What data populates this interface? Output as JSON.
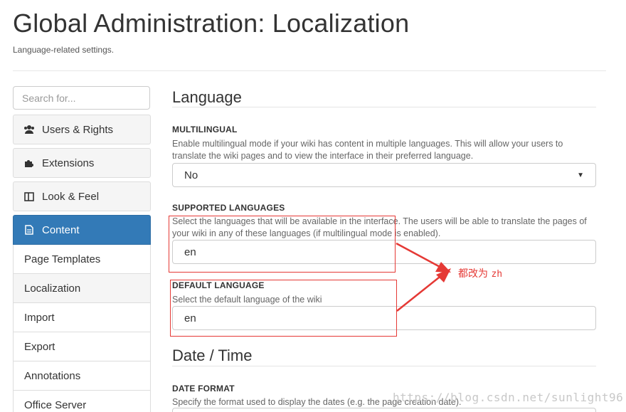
{
  "header": {
    "title": "Global Administration: Localization",
    "subtitle": "Language-related settings."
  },
  "sidebar": {
    "search_placeholder": "Search for...",
    "categories": [
      {
        "label": "Users & Rights",
        "icon": "users-icon"
      },
      {
        "label": "Extensions",
        "icon": "puzzle-icon"
      },
      {
        "label": "Look & Feel",
        "icon": "columns-icon"
      },
      {
        "label": "Content",
        "icon": "document-icon",
        "active": true
      }
    ],
    "sub_items": [
      {
        "label": "Page Templates"
      },
      {
        "label": "Localization",
        "selected": true
      },
      {
        "label": "Import"
      },
      {
        "label": "Export"
      },
      {
        "label": "Annotations"
      },
      {
        "label": "Office Server"
      }
    ]
  },
  "main": {
    "language_section": {
      "title": "Language",
      "multilingual": {
        "label": "MULTILINGUAL",
        "help": "Enable multilingual mode if your wiki has content in multiple languages. This will allow your users to translate the wiki pages and to view the interface in their preferred language.",
        "value": "No"
      },
      "supported_languages": {
        "label": "SUPPORTED LANGUAGES",
        "help": "Select the languages that will be available in the interface. The users will be able to translate the pages of your wiki in any of these languages (if multilingual mode is enabled).",
        "value": "en"
      },
      "default_language": {
        "label": "DEFAULT LANGUAGE",
        "help": "Select the default language of the wiki",
        "value": "en"
      }
    },
    "datetime_section": {
      "title": "Date / Time",
      "date_format": {
        "label": "DATE FORMAT",
        "help": "Specify the format used to display the dates (e.g. the page creation date)."
      }
    }
  },
  "annotation": {
    "note_cn": "都改为",
    "note_code": "zh",
    "color": "#e53935"
  },
  "watermark": "https://blog.csdn.net/sunlight96"
}
